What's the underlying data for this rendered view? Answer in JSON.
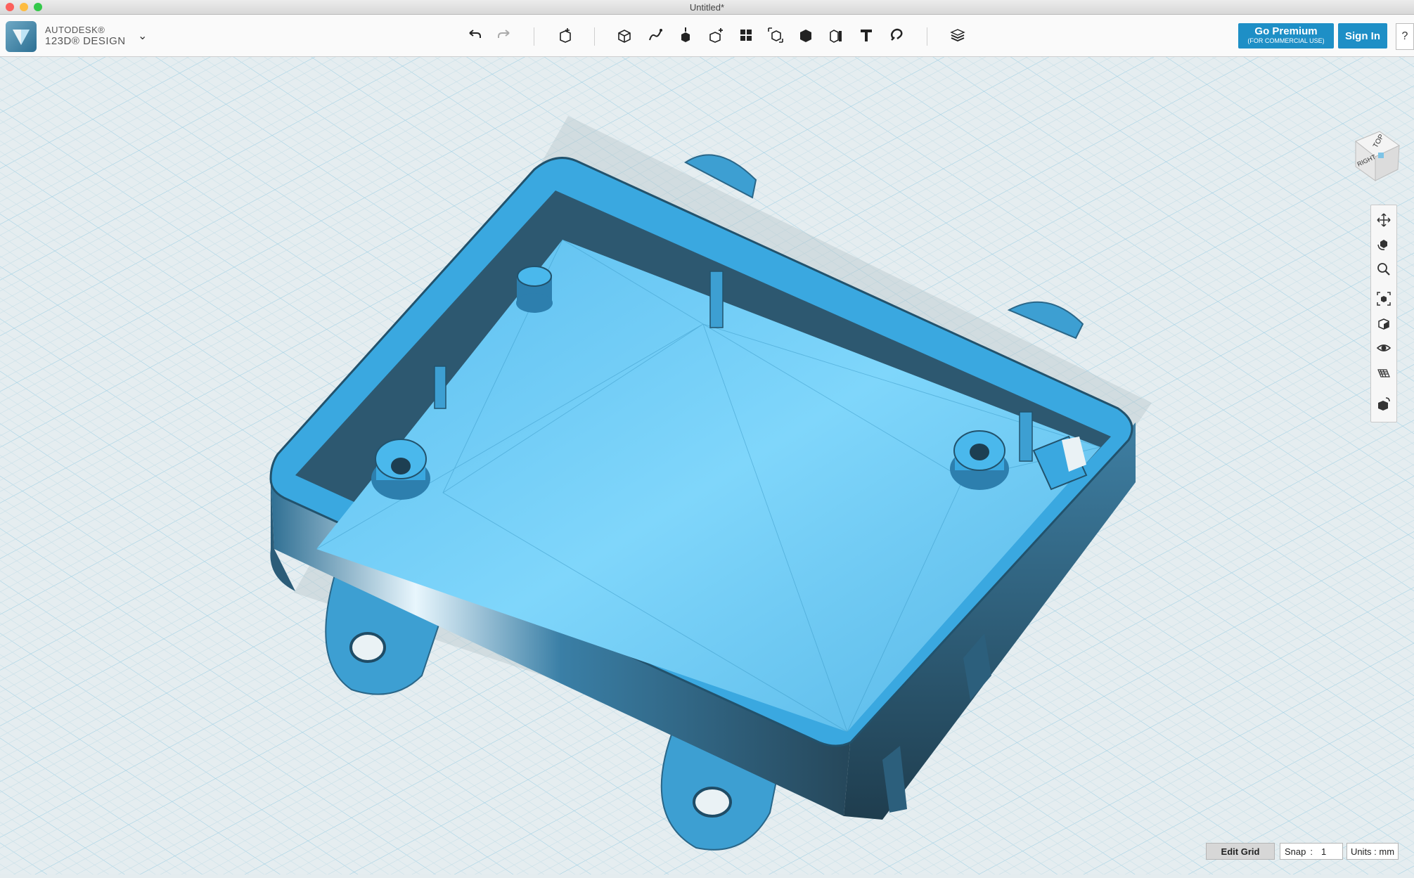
{
  "window": {
    "title": "Untitled*"
  },
  "brand": {
    "line1": "AUTODESK®",
    "line2": "123D® DESIGN"
  },
  "toolbar": {
    "tools": [
      "undo-icon",
      "redo-icon",
      "primitives-icon",
      "sketch-icon",
      "construct-icon",
      "modify-icon",
      "pattern-icon",
      "grouping-icon",
      "combine-icon",
      "measure-icon",
      "text-icon",
      "snap-icon",
      "materials-icon"
    ]
  },
  "account": {
    "premium_label": "Go Premium",
    "premium_sub": "(FOR COMMERCIAL USE)",
    "signin_label": "Sign In",
    "help_label": "?"
  },
  "viewcube": {
    "top_label": "TOP",
    "right_label": "RIGHT"
  },
  "navbar": {
    "tools": [
      "pan-icon",
      "orbit-icon",
      "zoom-icon",
      "fit-icon",
      "view-icon",
      "visibility-icon",
      "grid-icon",
      "material-icon"
    ]
  },
  "status": {
    "edit_grid_label": "Edit Grid",
    "snap_label": "Snap",
    "snap_sep": ":",
    "snap_value": "1",
    "units_label": "Units : mm"
  },
  "colors": {
    "accent": "#1e8fc6",
    "model": "#4fb6ea",
    "model_dark": "#2b4a5c",
    "grid": "#8ec4dd"
  }
}
